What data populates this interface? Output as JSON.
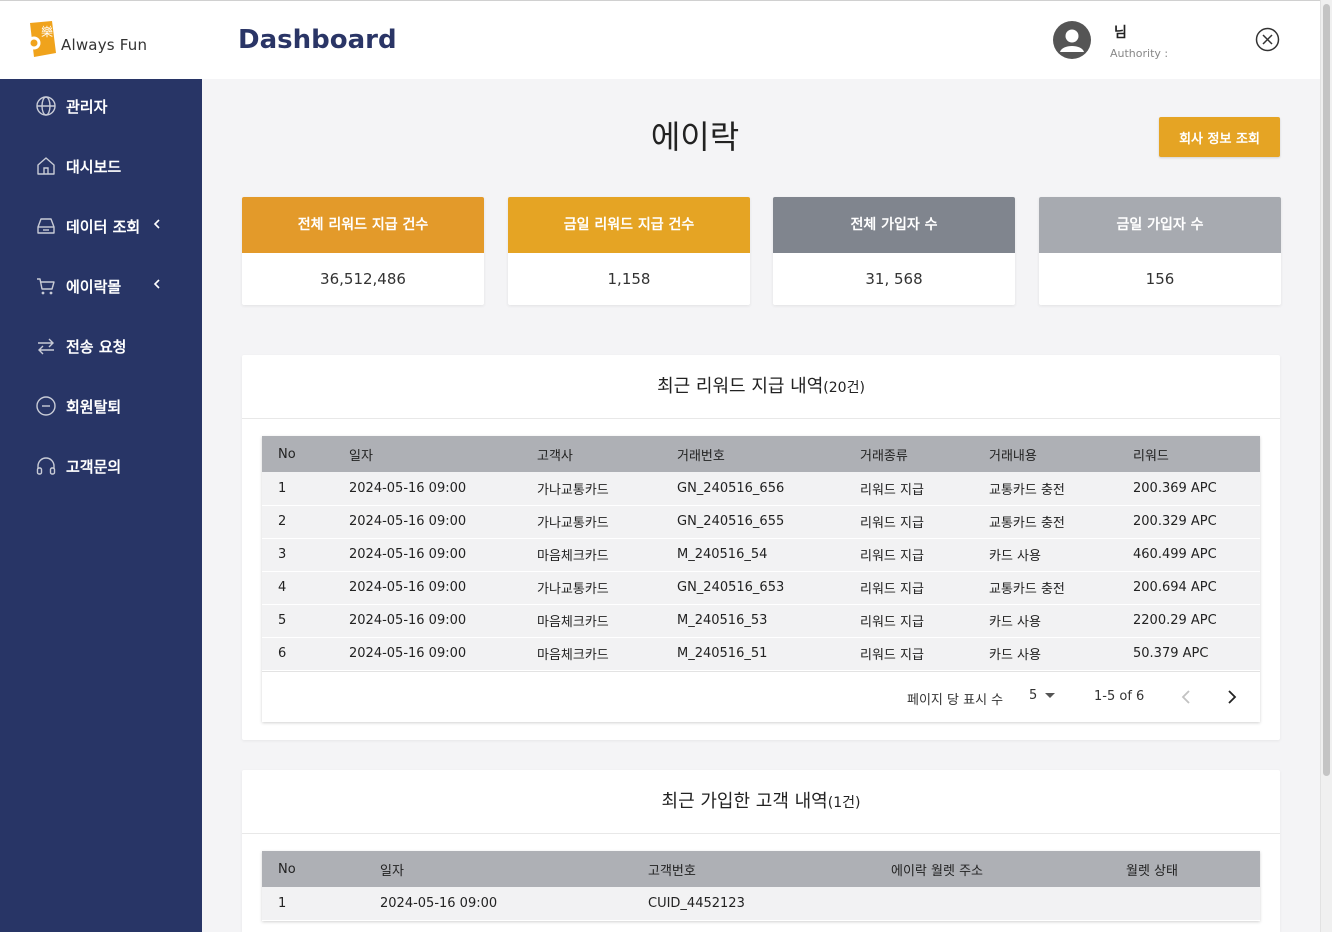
{
  "header": {
    "logo_text": "Always Fun",
    "logo_glyph": "樂",
    "page_title": "Dashboard",
    "user_name": "님",
    "user_authority": "Authority :"
  },
  "sidebar": {
    "items": [
      {
        "label": "관리자",
        "icon": "globe-icon",
        "has_chevron": false
      },
      {
        "label": "대시보드",
        "icon": "home-icon",
        "has_chevron": false
      },
      {
        "label": "데이터 조회",
        "icon": "inbox-icon",
        "has_chevron": true
      },
      {
        "label": "에이락몰",
        "icon": "cart-icon",
        "has_chevron": true
      },
      {
        "label": "전송 요청",
        "icon": "transfer-icon",
        "has_chevron": false
      },
      {
        "label": "회원탈퇴",
        "icon": "minus-circle-icon",
        "has_chevron": false
      },
      {
        "label": "고객문의",
        "icon": "headset-icon",
        "has_chevron": false
      }
    ]
  },
  "main": {
    "company_name": "에이락",
    "company_button": "회사 정보 조회",
    "stats": [
      {
        "label": "전체 리워드 지급 건수",
        "value": "36,512,486",
        "color": "#e39a2a"
      },
      {
        "label": "금일 리워드 지급 건수",
        "value": "1,158",
        "color": "#e5a424"
      },
      {
        "label": "전체 가입자 수",
        "value": "31, 568",
        "color": "#80858e"
      },
      {
        "label": "금일 가입자 수",
        "value": "156",
        "color": "#a7aab0"
      }
    ]
  },
  "rewards": {
    "title": "최근 리워드 지급 내역",
    "count": "(20건)",
    "columns": [
      "No",
      "일자",
      "고객사",
      "거래번호",
      "거래종류",
      "거래내용",
      "리워드"
    ],
    "rows": [
      [
        "1",
        "2024-05-16 09:00",
        "가나교통카드",
        "GN_240516_656",
        "리워드 지급",
        "교통카드 충전",
        "200.369 APC"
      ],
      [
        "2",
        "2024-05-16 09:00",
        "가나교통카드",
        "GN_240516_655",
        "리워드 지급",
        "교통카드 충전",
        "200.329 APC"
      ],
      [
        "3",
        "2024-05-16 09:00",
        "마음체크카드",
        "M_240516_54",
        "리워드 지급",
        "카드 사용",
        "460.499 APC"
      ],
      [
        "4",
        "2024-05-16 09:00",
        "가나교통카드",
        "GN_240516_653",
        "리워드 지급",
        "교통카드 충전",
        "200.694 APC"
      ],
      [
        "5",
        "2024-05-16 09:00",
        "마음체크카드",
        "M_240516_53",
        "리워드 지급",
        "카드 사용",
        "2200.29 APC"
      ],
      [
        "6",
        "2024-05-16 09:00",
        "마음체크카드",
        "M_240516_51",
        "리워드 지급",
        "카드 사용",
        "50.379 APC"
      ]
    ],
    "pager": {
      "rows_per_page_label": "페이지 당 표시 수",
      "rows_per_page": "5",
      "range": "1-5 of 6"
    }
  },
  "signups": {
    "title": "최근 가입한 고객 내역",
    "count": "(1건)",
    "columns": [
      "No",
      "일자",
      "고객번호",
      "에이락 월렛 주소",
      "월렛 상태"
    ],
    "rows": [
      [
        "1",
        "2024-05-16 09:00",
        "CUID_4452123",
        "",
        ""
      ]
    ]
  }
}
